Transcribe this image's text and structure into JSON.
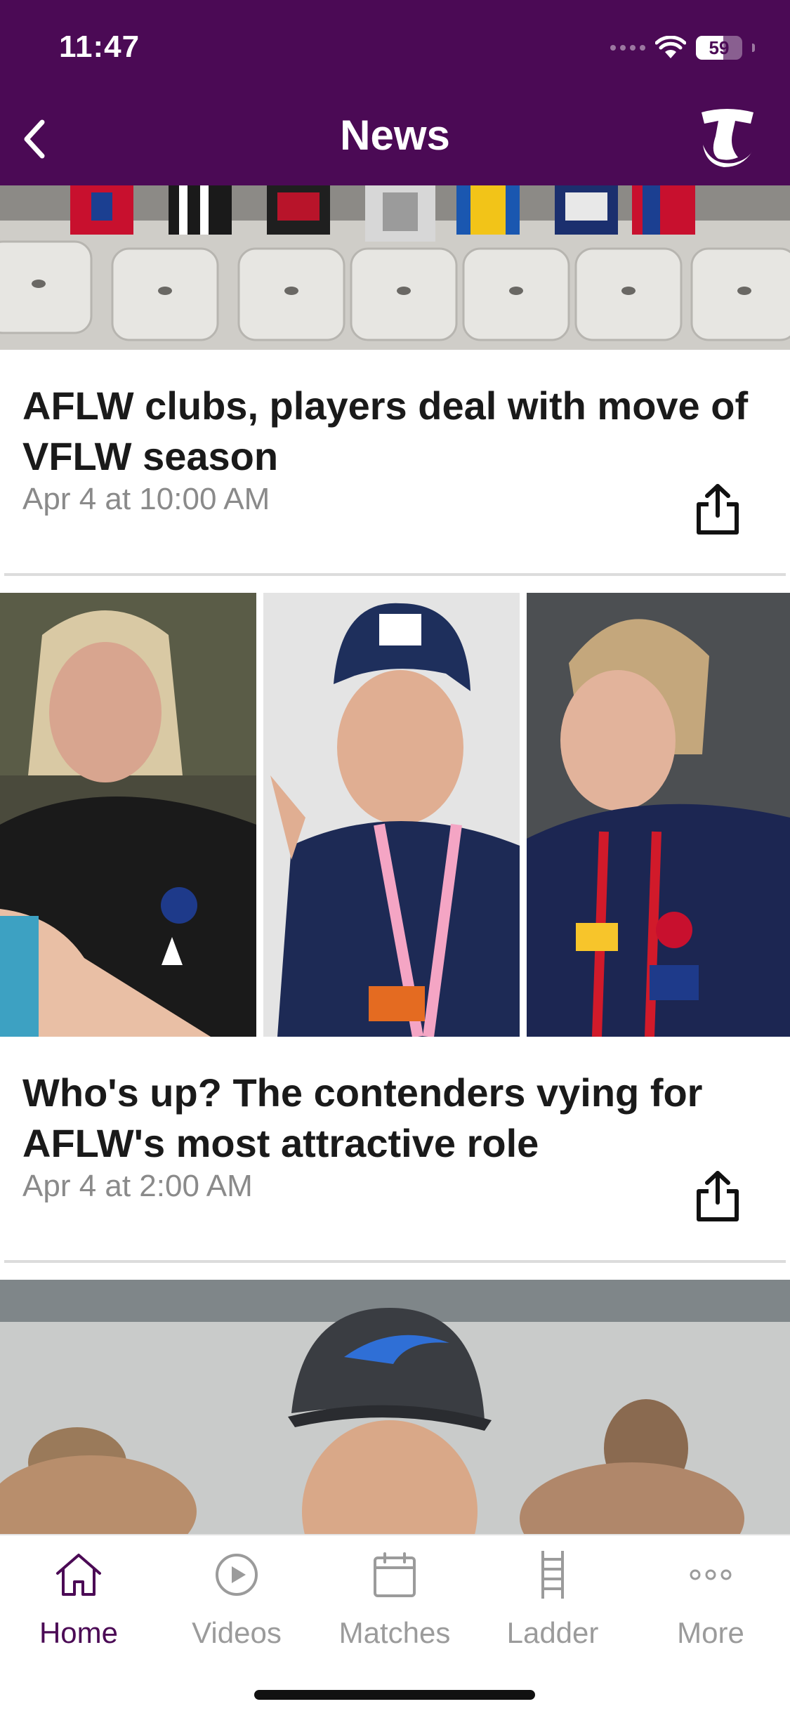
{
  "status_bar": {
    "time": "11:47",
    "battery": "59",
    "battery_level_percent": 59
  },
  "header": {
    "title": "News",
    "logo_name": "telstra-logo"
  },
  "articles": [
    {
      "title": "AFLW clubs, players deal with move of VFLW season",
      "date": "Apr 4 at 10:00 AM"
    },
    {
      "title": "Who's up? The contenders vying for AFLW's most attractive role",
      "date": "Apr 4 at 2:00 AM"
    }
  ],
  "tabs": [
    {
      "label": "Home",
      "icon": "home-icon",
      "active": true
    },
    {
      "label": "Videos",
      "icon": "play-icon",
      "active": false
    },
    {
      "label": "Matches",
      "icon": "calendar-icon",
      "active": false
    },
    {
      "label": "Ladder",
      "icon": "ladder-icon",
      "active": false
    },
    {
      "label": "More",
      "icon": "more-icon",
      "active": false
    }
  ],
  "colors": {
    "brand": "#4b0a55",
    "inactive_tab": "#9b9b9b",
    "date_text": "#8a8a8a"
  }
}
